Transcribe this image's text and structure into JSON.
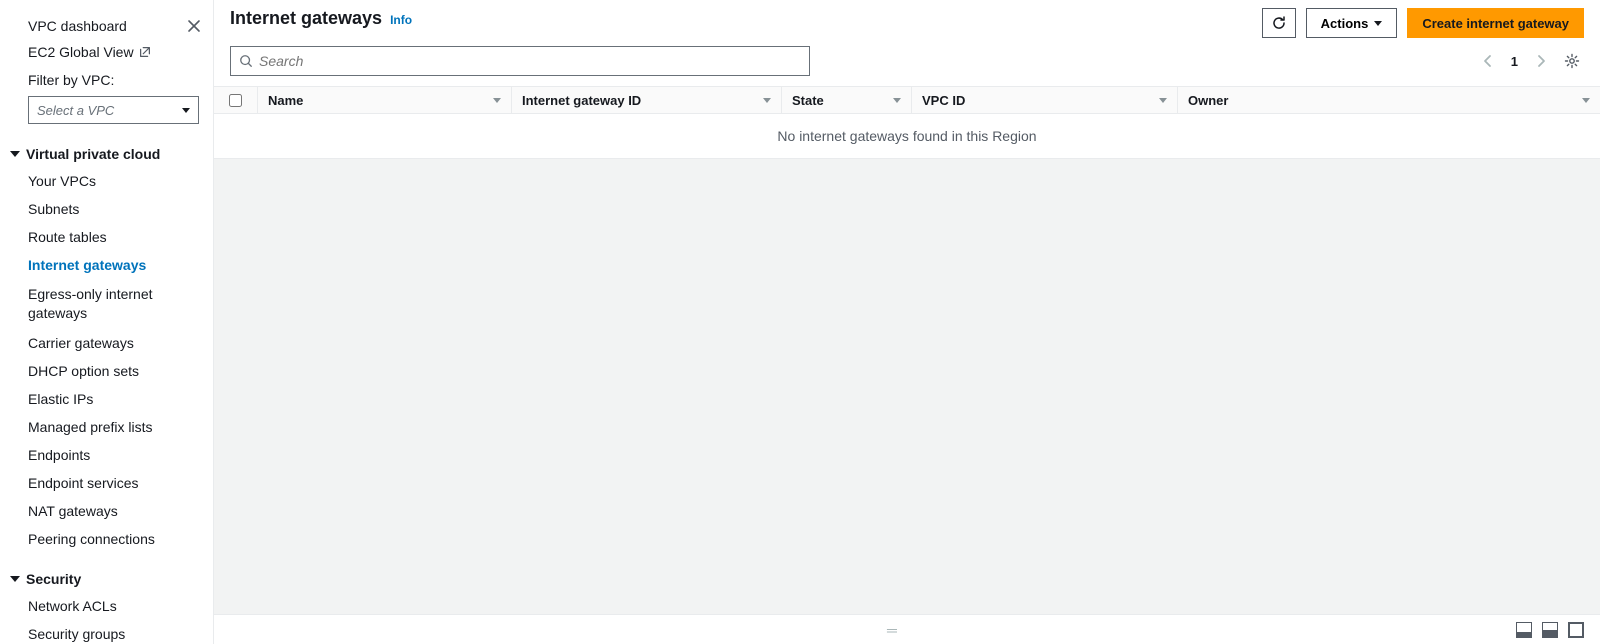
{
  "sidebar": {
    "dashboard_label": "VPC dashboard",
    "global_view_label": "EC2 Global View",
    "filter_label": "Filter by VPC:",
    "vpc_select_placeholder": "Select a VPC",
    "section_vpc": {
      "title": "Virtual private cloud",
      "items": [
        "Your VPCs",
        "Subnets",
        "Route tables",
        "Internet gateways",
        "Egress-only internet gateways",
        "Carrier gateways",
        "DHCP option sets",
        "Elastic IPs",
        "Managed prefix lists",
        "Endpoints",
        "Endpoint services",
        "NAT gateways",
        "Peering connections"
      ],
      "active_index": 3
    },
    "section_security": {
      "title": "Security",
      "items": [
        "Network ACLs",
        "Security groups"
      ]
    }
  },
  "header": {
    "title": "Internet gateways",
    "info_label": "Info",
    "actions_label": "Actions",
    "create_label": "Create internet gateway"
  },
  "search": {
    "placeholder": "Search",
    "value": ""
  },
  "pager": {
    "page": "1"
  },
  "table": {
    "columns": [
      "Name",
      "Internet gateway ID",
      "State",
      "VPC ID",
      "Owner"
    ],
    "empty_message": "No internet gateways found in this Region"
  }
}
